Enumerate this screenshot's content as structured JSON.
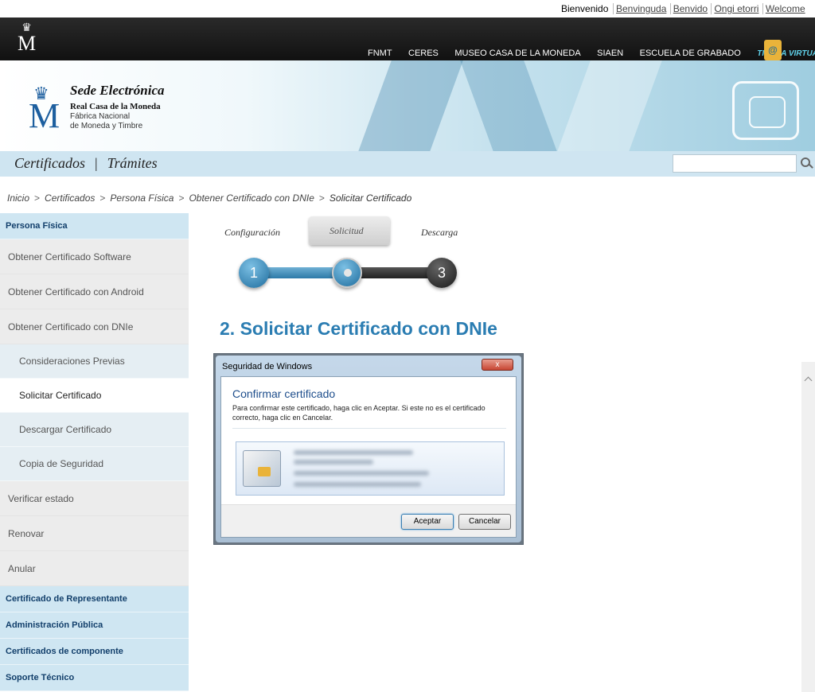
{
  "langbar": {
    "welcome": "Bienvenido",
    "languages": [
      "Benvinguda",
      "Benvido",
      "Ongi etorri",
      "Welcome"
    ]
  },
  "topbar": {
    "nav": [
      "FNMT",
      "CERES",
      "MUSEO CASA DE LA MONEDA",
      "SIAEN",
      "ESCUELA DE GRABADO"
    ],
    "store": "TIENDA VIRTUAL",
    "store_icon": "shopping-bag-icon"
  },
  "banner": {
    "title": "Sede Electrónica",
    "subtitle1": "Real Casa de la Moneda",
    "subtitle2": "Fábrica Nacional",
    "subtitle3": "de Moneda y Timbre"
  },
  "sectionbar": {
    "link1": "Certificados",
    "separator": "|",
    "link2": "Trámites",
    "search_placeholder": "",
    "search_icon": "search-icon"
  },
  "breadcrumb": {
    "items": [
      "Inicio",
      "Certificados",
      "Persona Física",
      "Obtener Certificado con DNIe"
    ],
    "current": "Solicitar Certificado",
    "separator": ">"
  },
  "sidebar": {
    "head1": "Persona Física",
    "items": [
      "Obtener Certificado Software",
      "Obtener Certificado con Android",
      "Obtener Certificado con DNIe"
    ],
    "subitems": [
      "Consideraciones Previas",
      "Solicitar Certificado",
      "Descargar Certificado",
      "Copia de Seguridad"
    ],
    "items2": [
      "Verificar estado",
      "Renovar",
      "Anular"
    ],
    "heads": [
      "Certificado de Representante",
      "Administración Pública",
      "Certificados de componente",
      "Soporte Técnico"
    ]
  },
  "steps": {
    "labels": [
      "Configuración",
      "Solicitud",
      "Descarga"
    ],
    "numbers": [
      "1",
      "",
      "3"
    ],
    "current_step": 2
  },
  "main": {
    "title": "2. Solicitar Certificado con DNIe"
  },
  "dialog": {
    "window_title": "Seguridad de Windows",
    "close": "x",
    "heading": "Confirmar certificado",
    "text": "Para confirmar este certificado, haga clic en Aceptar. Si este no es el certificado correcto, haga clic en Cancelar.",
    "accept": "Aceptar",
    "cancel": "Cancelar"
  },
  "colors": {
    "accent": "#2b7db2",
    "sidebar_head": "#cfe6f2",
    "topbar": "#1a1a1a"
  }
}
